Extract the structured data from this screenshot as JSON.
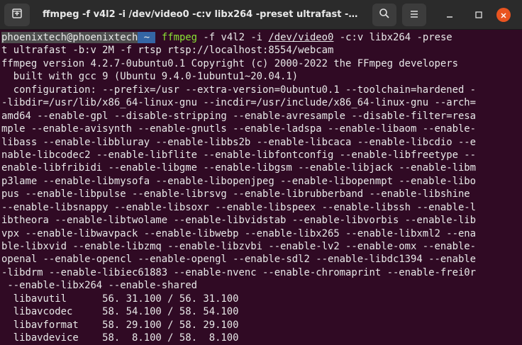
{
  "window": {
    "title": "ffmpeg -f v4l2 -i /dev/video0 -c:v libx264 -preset ultrafast -b:...",
    "icons": {
      "new_tab": "new-tab-icon",
      "search": "search-icon",
      "menu": "hamburger-menu-icon",
      "minimize": "minimize-icon",
      "maximize": "maximize-icon",
      "close": "close-icon"
    },
    "colors": {
      "terminal_bg": "#300a24",
      "titlebar_bg": "#2b2b2b",
      "close_accent": "#e95420",
      "command_green": "#8ae234",
      "prompt_dir_bg": "#3465a4",
      "prompt_user_bg": "#4e4e4e"
    }
  },
  "prompt": {
    "user": "phoenixtech@phoenixtech",
    "arrow": "",
    "dir": "~",
    "cmd_name": "ffmpeg",
    "args_before_path": " -f v4l2 -i ",
    "path": "/dev/video0",
    "args_after_path": " -c:v libx264 -prese",
    "continuation": "t ultrafast -b:v 2M -f rtsp rtsp://localhost:8554/webcam"
  },
  "output_lines": [
    "ffmpeg version 4.2.7-0ubuntu0.1 Copyright (c) 2000-2022 the FFmpeg developers",
    "  built with gcc 9 (Ubuntu 9.4.0-1ubuntu1~20.04.1)",
    "  configuration: --prefix=/usr --extra-version=0ubuntu0.1 --toolchain=hardened -",
    "-libdir=/usr/lib/x86_64-linux-gnu --incdir=/usr/include/x86_64-linux-gnu --arch=",
    "amd64 --enable-gpl --disable-stripping --enable-avresample --disable-filter=resa",
    "mple --enable-avisynth --enable-gnutls --enable-ladspa --enable-libaom --enable-",
    "libass --enable-libbluray --enable-libbs2b --enable-libcaca --enable-libcdio --e",
    "nable-libcodec2 --enable-libflite --enable-libfontconfig --enable-libfreetype --",
    "enable-libfribidi --enable-libgme --enable-libgsm --enable-libjack --enable-libm",
    "p3lame --enable-libmysofa --enable-libopenjpeg --enable-libopenmpt --enable-libo",
    "pus --enable-libpulse --enable-librsvg --enable-librubberband --enable-libshine ",
    "--enable-libsnappy --enable-libsoxr --enable-libspeex --enable-libssh --enable-l",
    "ibtheora --enable-libtwolame --enable-libvidstab --enable-libvorbis --enable-lib",
    "vpx --enable-libwavpack --enable-libwebp --enable-libx265 --enable-libxml2 --ena",
    "ble-libxvid --enable-libzmq --enable-libzvbi --enable-lv2 --enable-omx --enable-",
    "openal --enable-opencl --enable-opengl --enable-sdl2 --enable-libdc1394 --enable",
    "-libdrm --enable-libiec61883 --enable-nvenc --enable-chromaprint --enable-frei0r",
    " --enable-libx264 --enable-shared",
    "  libavutil      56. 31.100 / 56. 31.100",
    "  libavcodec     58. 54.100 / 58. 54.100",
    "  libavformat    58. 29.100 / 58. 29.100",
    "  libavdevice    58.  8.100 / 58.  8.100"
  ]
}
